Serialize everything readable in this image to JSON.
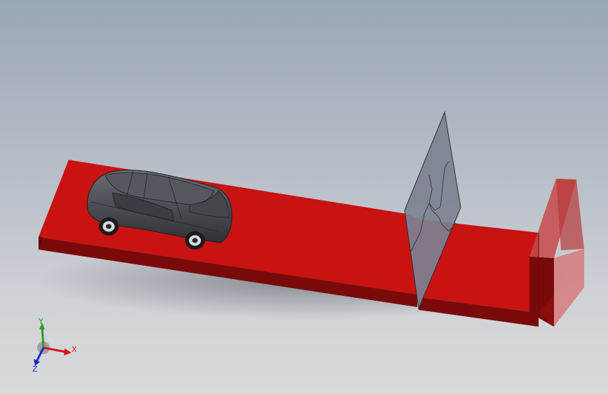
{
  "viewport": {
    "background_top": "#9aa7b7",
    "background_bottom": "#d9dadd"
  },
  "scene": {
    "track_color": "#c91212",
    "track_side_color": "#7a0a0a",
    "car_color": "#4a4c52",
    "panel_color": "#7d8290",
    "end_block_color": "#c83a3a"
  },
  "triad": {
    "x_label": "X",
    "y_label": "Y",
    "z_label": "Z",
    "x_color": "#d01818",
    "y_color": "#2a9a2a",
    "z_color": "#1a2ac8"
  }
}
